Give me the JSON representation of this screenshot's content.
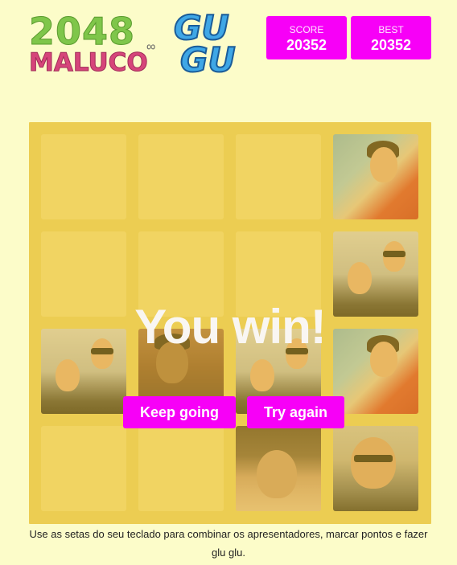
{
  "header": {
    "logo_number": "2048",
    "logo_word": "MALUCO",
    "logo_brand_top": "GU",
    "logo_brand_bottom": "GU"
  },
  "scores": {
    "score_label": "SCORE",
    "score_value": "20352",
    "best_label": "BEST",
    "best_value": "20352"
  },
  "overlay": {
    "message": "You win!",
    "keep_going": "Keep going",
    "try_again": "Try again"
  },
  "instructions": "Use as setas do seu teclado para combinar os apresentadores, marcar pontos e fazer glu glu.",
  "colors": {
    "background": "#fcfcc9",
    "board": "#ebd770",
    "empty_cell": "#f5e48d",
    "accent": "#f700f7"
  },
  "grid": [
    [
      "empty",
      "empty",
      "empty",
      "presenter-hearts"
    ],
    [
      "empty",
      "empty",
      "empty",
      "presenter-duo"
    ],
    [
      "presenter-duo",
      "presenter-brick",
      "presenter-duo",
      "presenter-hearts"
    ],
    [
      "empty",
      "empty",
      "presenter-wig",
      "presenter-shades"
    ]
  ]
}
